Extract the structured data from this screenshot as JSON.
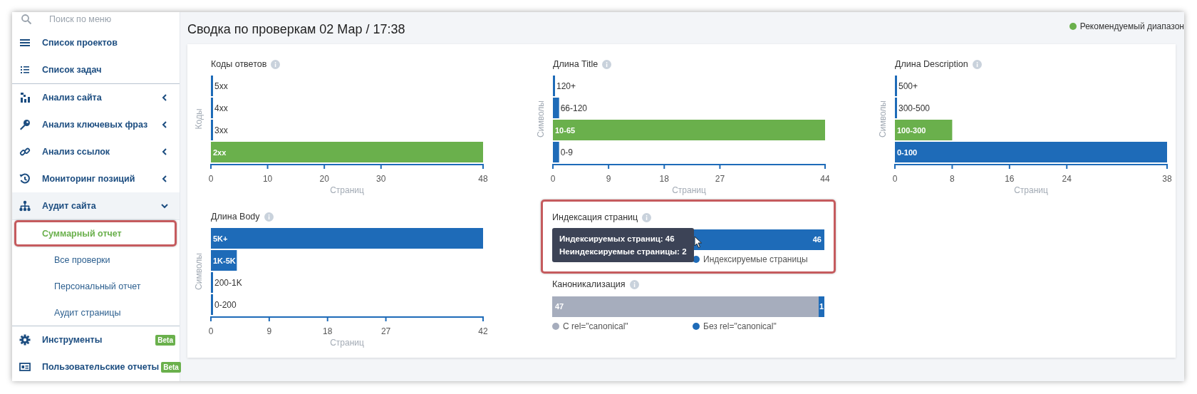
{
  "sidebar": {
    "search": {
      "placeholder": "Поиск по меню"
    },
    "sections": [
      [
        {
          "label": "Список проектов",
          "kind": "link"
        },
        {
          "label": "Список задач",
          "kind": "link"
        }
      ],
      [
        {
          "label": "Анализ сайта",
          "kind": "group",
          "expanded": false
        },
        {
          "label": "Анализ ключевых фраз",
          "kind": "group",
          "expanded": false
        },
        {
          "label": "Анализ ссылок",
          "kind": "group",
          "expanded": false
        },
        {
          "label": "Мониторинг позиций",
          "kind": "group",
          "expanded": false
        },
        {
          "label": "Аудит сайта",
          "kind": "group",
          "expanded": true,
          "children": [
            {
              "label": "Суммарный отчет",
              "selected": true,
              "highlighted": true
            },
            {
              "label": "Все проверки",
              "selected": false,
              "highlighted": false
            },
            {
              "label": "Персональный отчет",
              "selected": false,
              "highlighted": false
            },
            {
              "label": "Аудит страницы",
              "selected": false,
              "highlighted": false
            }
          ]
        }
      ],
      [
        {
          "label": "Инструменты",
          "kind": "link",
          "badge": "Beta"
        },
        {
          "label": "Пользовательские отчеты",
          "kind": "link",
          "badge": "Beta"
        }
      ]
    ]
  },
  "main": {
    "title": "Сводка по проверкам 02 Мар / 17:38",
    "legend": {
      "label": "Рекомендуемый диапазон",
      "color": "#6ab04c"
    },
    "panels": [
      [
        {
          "kind": "bar",
          "title": "Коды ответов",
          "recommended": [
            false,
            false,
            false,
            true
          ],
          "chart_data": {
            "type": "bar",
            "orientation": "horizontal",
            "ylabel": "Коды",
            "xlabel": "Страниц",
            "categories": [
              "5xx",
              "4xx",
              "3xx",
              "2xx"
            ],
            "values": [
              0,
              0,
              0,
              48
            ],
            "xlim": [
              0,
              48
            ],
            "xticks": [
              0,
              10,
              20,
              30,
              48
            ]
          }
        }
      ],
      [
        {
          "kind": "bar",
          "title": "Длина Title",
          "recommended": [
            false,
            false,
            true,
            false
          ],
          "chart_data": {
            "type": "bar",
            "orientation": "horizontal",
            "ylabel": "Символы",
            "xlabel": "Страниц",
            "categories": [
              "120+",
              "66-120",
              "10-65",
              "0-9"
            ],
            "values": [
              0,
              1,
              44,
              1
            ],
            "xlim": [
              0,
              44
            ],
            "xticks": [
              0,
              9,
              18,
              27,
              44
            ]
          }
        }
      ],
      [
        {
          "kind": "bar",
          "title": "Длина Description",
          "recommended": [
            false,
            false,
            true,
            false
          ],
          "chart_data": {
            "type": "bar",
            "orientation": "horizontal",
            "ylabel": "Символы",
            "xlabel": "Страниц",
            "categories": [
              "500+",
              "300-500",
              "100-300",
              "0-100"
            ],
            "values": [
              0,
              0,
              8,
              38
            ],
            "xlim": [
              0,
              38
            ],
            "xticks": [
              0,
              8,
              16,
              24,
              38
            ]
          }
        }
      ],
      [
        {
          "kind": "bar",
          "title": "Длина Body",
          "recommended": [
            false,
            false,
            false,
            false
          ],
          "chart_data": {
            "type": "bar",
            "orientation": "horizontal",
            "ylabel": "Символы",
            "xlabel": "Страниц",
            "categories": [
              "5K+",
              "1K-5K",
              "200-1K",
              "0-200"
            ],
            "values": [
              42,
              4,
              0,
              0
            ],
            "xlim": [
              0,
              42
            ],
            "xticks": [
              0,
              9,
              18,
              27,
              42
            ]
          }
        }
      ],
      [
        {
          "kind": "meter",
          "title": "Индексация страниц",
          "highlighted": true,
          "tooltip": {
            "lines": [
              "Индексируемых страниц: 46",
              "Неиндексируемые страницы: 2"
            ]
          },
          "bar": {
            "level": 0.958,
            "fill_label": "46"
          },
          "legend": [
            {
              "label": "Индексируемые страницы",
              "color": "#1e6bb8"
            }
          ]
        },
        {
          "kind": "meter",
          "title": "Каноникализация",
          "bar": {
            "level": 0.021,
            "track_label": "47",
            "fill_label": "1"
          },
          "legend": [
            {
              "label": "C rel=\"canonical\"",
              "color": "#a6adbd"
            },
            {
              "label": "Без rel=\"canonical\"",
              "color": "#1e6bb8"
            }
          ]
        }
      ]
    ]
  }
}
